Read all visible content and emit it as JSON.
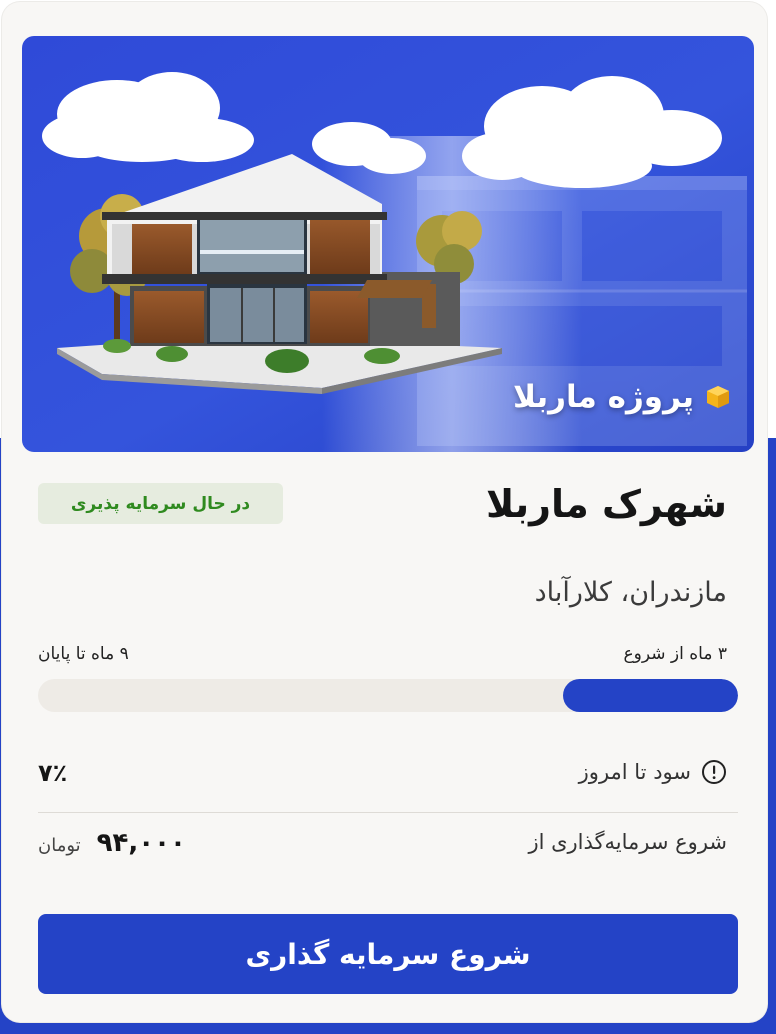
{
  "hero": {
    "label": "پروژه ماربلا",
    "icon": "box-icon"
  },
  "project": {
    "status": "در حال سرمایه پذیری",
    "title": "شهرک ماربلا",
    "location": "مازندران، کلارآباد"
  },
  "timeline": {
    "since_start": "۳ ماه از شروع",
    "to_end": "۹ ماه تا پایان",
    "progress_fraction": 0.25
  },
  "profit": {
    "label": "سود تا امروز",
    "icon": "info-icon",
    "value": "۷٪"
  },
  "investment": {
    "label": "شروع سرمایه‌گذاری از",
    "amount": "۹۴,۰۰۰",
    "unit": "تومان"
  },
  "cta": {
    "label": "شروع سرمایه گذاری"
  },
  "colors": {
    "primary": "#2443c6",
    "status_text": "#2f8a1f",
    "status_bg": "#e6ecdf",
    "track": "#eeebe6"
  }
}
